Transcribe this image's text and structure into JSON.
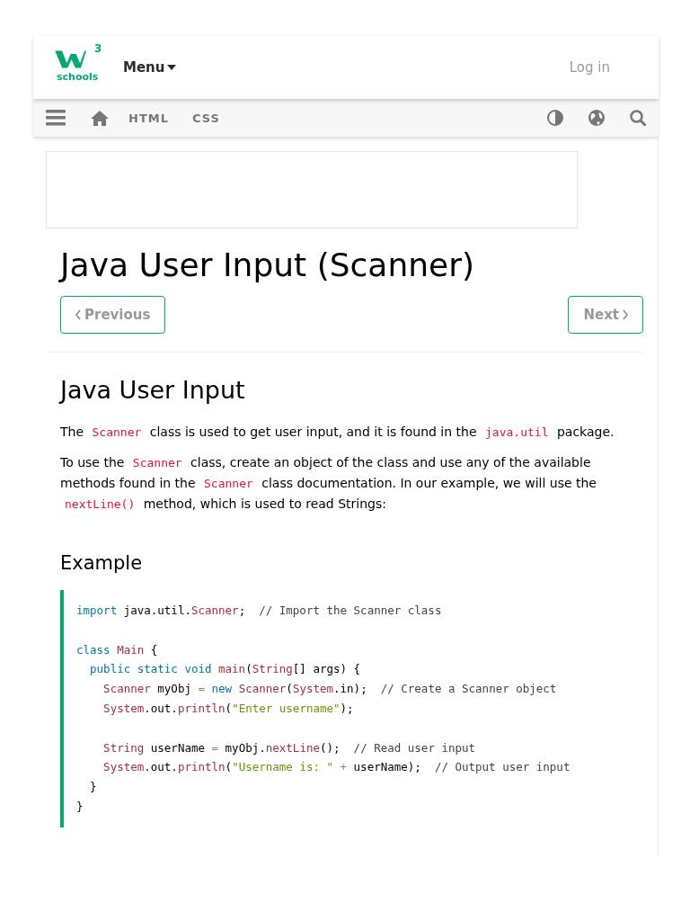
{
  "header": {
    "logo_sup": "3",
    "logo_text": "schools",
    "menu": "Menu",
    "login": "Log in"
  },
  "nav": {
    "items": [
      {
        "label": "HTML"
      },
      {
        "label": "CSS"
      }
    ]
  },
  "title": "Java User Input (Scanner)",
  "pager": {
    "previous": "Previous",
    "next": "Next"
  },
  "section_title": "Java User Input",
  "paragraphs": [
    [
      {
        "kind": "text",
        "text": "The "
      },
      {
        "kind": "code",
        "text": "Scanner"
      },
      {
        "kind": "text",
        "text": " class is used to get user input, and it is found in the "
      },
      {
        "kind": "code",
        "text": "java.util"
      },
      {
        "kind": "text",
        "text": " package."
      }
    ],
    [
      {
        "kind": "text",
        "text": "To use the "
      },
      {
        "kind": "code",
        "text": "Scanner"
      },
      {
        "kind": "text",
        "text": " class, create an object of the class and use any of the available methods found in the "
      },
      {
        "kind": "code",
        "text": "Scanner"
      },
      {
        "kind": "text",
        "text": " class documentation. In our example, we will use the "
      },
      {
        "kind": "code",
        "text": "nextLine()"
      },
      {
        "kind": "text",
        "text": " method, which is used to read Strings:"
      }
    ]
  ],
  "example": {
    "title": "Example",
    "lines": [
      {
        "kind": "code",
        "tokens": [
          {
            "kind": "keyword",
            "text": "import"
          },
          {
            "kind": "plain",
            "text": " java.util."
          },
          {
            "kind": "name",
            "text": "Scanner"
          },
          {
            "kind": "plain",
            "text": ";  "
          },
          {
            "kind": "comment",
            "text": "// Import the Scanner class"
          }
        ]
      },
      {
        "kind": "blank"
      },
      {
        "kind": "code",
        "tokens": [
          {
            "kind": "keyword",
            "text": "class "
          },
          {
            "kind": "name",
            "text": "Main"
          },
          {
            "kind": "plain",
            "text": " {"
          }
        ]
      },
      {
        "kind": "code",
        "tokens": [
          {
            "kind": "keyword",
            "text": "  public static void "
          },
          {
            "kind": "name",
            "text": "main"
          },
          {
            "kind": "plain",
            "text": "("
          },
          {
            "kind": "name",
            "text": "String"
          },
          {
            "kind": "plain",
            "text": "[] args) {"
          }
        ]
      },
      {
        "kind": "code",
        "tokens": [
          {
            "kind": "name",
            "text": "    Scanner"
          },
          {
            "kind": "plain",
            "text": " myObj "
          },
          {
            "kind": "operator",
            "text": "="
          },
          {
            "kind": "keyword",
            "text": " new "
          },
          {
            "kind": "name",
            "text": "Scanner"
          },
          {
            "kind": "plain",
            "text": "("
          },
          {
            "kind": "name",
            "text": "System"
          },
          {
            "kind": "plain",
            "text": ".in);  "
          },
          {
            "kind": "comment",
            "text": "// Create a Scanner object"
          }
        ]
      },
      {
        "kind": "code",
        "tokens": [
          {
            "kind": "name",
            "text": "    System"
          },
          {
            "kind": "plain",
            "text": ".out."
          },
          {
            "kind": "name",
            "text": "println"
          },
          {
            "kind": "plain",
            "text": "("
          },
          {
            "kind": "string",
            "text": "\"Enter username\""
          },
          {
            "kind": "plain",
            "text": ");"
          }
        ]
      },
      {
        "kind": "blank"
      },
      {
        "kind": "code",
        "tokens": [
          {
            "kind": "name",
            "text": "    String"
          },
          {
            "kind": "plain",
            "text": " userName "
          },
          {
            "kind": "operator",
            "text": "="
          },
          {
            "kind": "plain",
            "text": " myObj."
          },
          {
            "kind": "name",
            "text": "nextLine"
          },
          {
            "kind": "plain",
            "text": "();  "
          },
          {
            "kind": "comment",
            "text": "// Read user input"
          }
        ]
      },
      {
        "kind": "code",
        "tokens": [
          {
            "kind": "name",
            "text": "    System"
          },
          {
            "kind": "plain",
            "text": ".out."
          },
          {
            "kind": "name",
            "text": "println"
          },
          {
            "kind": "plain",
            "text": "("
          },
          {
            "kind": "string",
            "text": "\"Username is: \""
          },
          {
            "kind": "operator",
            "text": " + "
          },
          {
            "kind": "plain",
            "text": "userName);  "
          },
          {
            "kind": "comment",
            "text": "// Output user input"
          }
        ]
      },
      {
        "kind": "code",
        "tokens": [
          {
            "kind": "plain",
            "text": "  }"
          }
        ]
      },
      {
        "kind": "code",
        "tokens": [
          {
            "kind": "plain",
            "text": "}"
          }
        ]
      }
    ]
  }
}
